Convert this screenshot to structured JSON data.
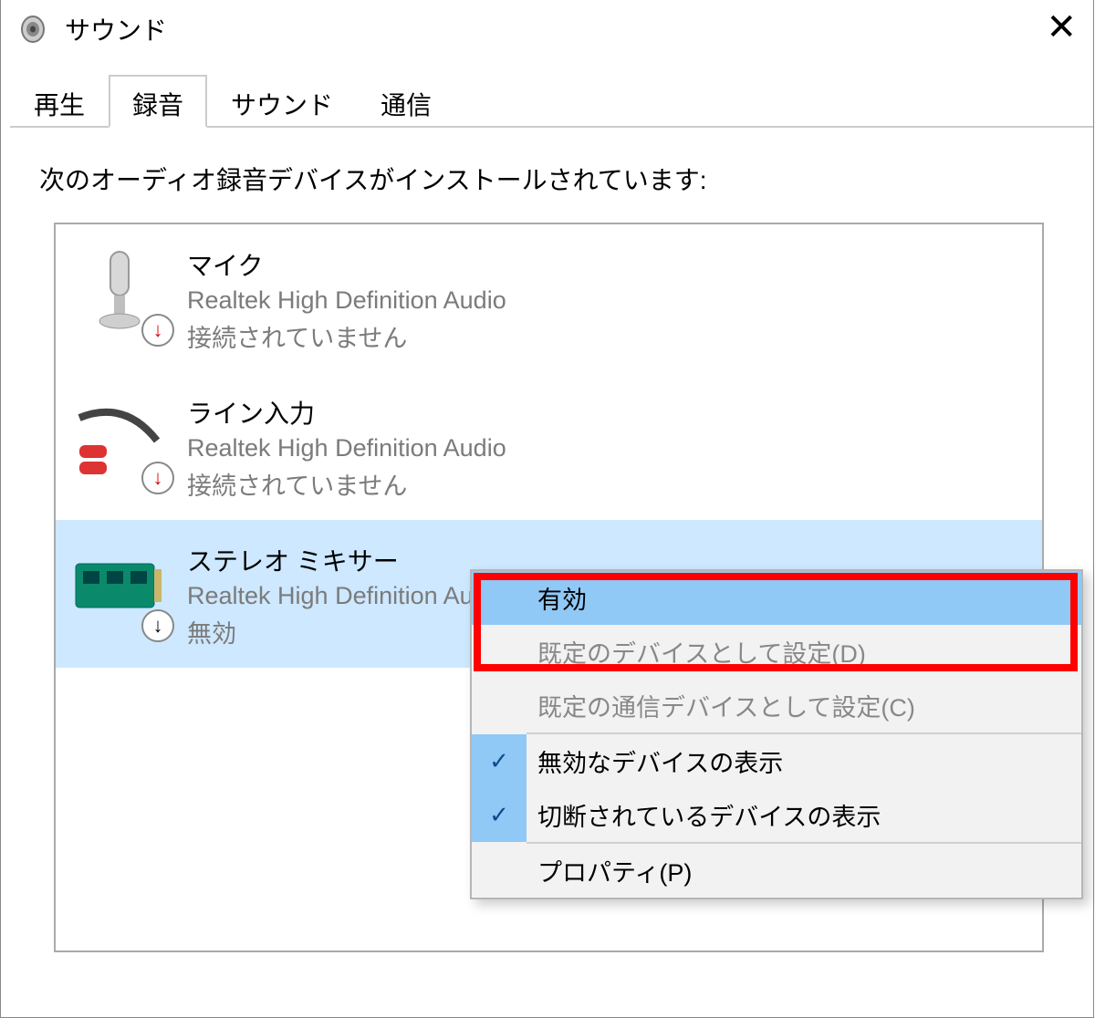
{
  "window": {
    "title": "サウンド"
  },
  "tabs": [
    {
      "label": "再生"
    },
    {
      "label": "録音",
      "active": true
    },
    {
      "label": "サウンド"
    },
    {
      "label": "通信"
    }
  ],
  "heading": "次のオーディオ録音デバイスがインストールされています:",
  "devices": [
    {
      "name": "マイク",
      "driver": "Realtek High Definition Audio",
      "status": "接続されていません",
      "badge": "red"
    },
    {
      "name": "ライン入力",
      "driver": "Realtek High Definition Audio",
      "status": "接続されていません",
      "badge": "red"
    },
    {
      "name": "ステレオ ミキサー",
      "driver": "Realtek High Definition Audio",
      "status": "無効",
      "badge": "black",
      "selected": true
    }
  ],
  "context_menu": {
    "items": [
      {
        "label": "有効",
        "highlight": true
      },
      {
        "label": "既定のデバイスとして設定(D)",
        "disabled": true
      },
      {
        "label": "既定の通信デバイスとして設定(C)",
        "disabled": true
      },
      {
        "sep": true
      },
      {
        "label": "無効なデバイスの表示",
        "checked": true
      },
      {
        "label": "切断されているデバイスの表示",
        "checked": true
      },
      {
        "sep": true
      },
      {
        "label": "プロパティ(P)"
      }
    ]
  }
}
